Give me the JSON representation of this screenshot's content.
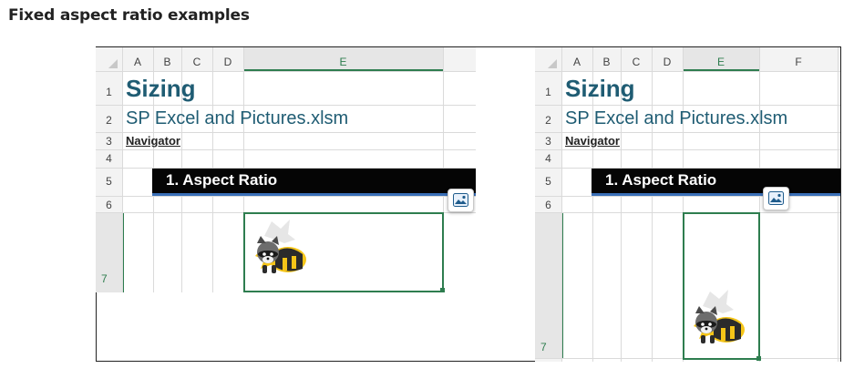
{
  "page": {
    "title": "Fixed aspect ratio examples"
  },
  "examples": [
    {
      "columns": [
        "A",
        "B",
        "C",
        "D",
        "E"
      ],
      "rows": [
        "1",
        "2",
        "3",
        "4",
        "5",
        "6",
        "7"
      ],
      "selected_column": "E",
      "selected_row": "7",
      "sizing_text": "Sizing",
      "file_text": "SP Excel and Pictures.xlsm",
      "navigator_text": "Navigator",
      "banner_text": "1. Aspect Ratio",
      "image_icon": "picture-icon",
      "picture": "raccoon-illustration"
    },
    {
      "columns": [
        "A",
        "B",
        "C",
        "D",
        "E",
        "F"
      ],
      "rows": [
        "1",
        "2",
        "3",
        "4",
        "5",
        "6",
        "7"
      ],
      "selected_column": "E",
      "selected_row": "7",
      "sizing_text": "Sizing",
      "file_text": "SP Excel and Pictures.xlsm",
      "navigator_text": "Navigator",
      "banner_text": "1. Aspect Ratio",
      "image_icon": "picture-icon",
      "picture": "raccoon-illustration"
    }
  ],
  "colors": {
    "accent": "#2e7d4f",
    "title_text": "#1f5c73",
    "banner": "#050505",
    "banner_underline": "#3a6fb7"
  }
}
